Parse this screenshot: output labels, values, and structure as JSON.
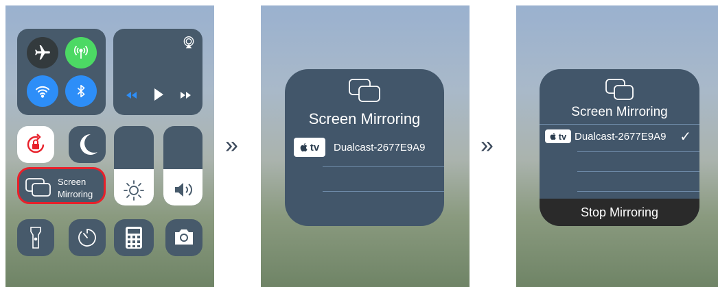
{
  "control_center": {
    "mirroring_label_line1": "Screen",
    "mirroring_label_line2": "Mirroring",
    "colors": {
      "highlight_outline": "#e8202a",
      "cellular_green": "#4cd964",
      "blue": "#2d8ef8"
    },
    "icons": [
      "airplane-icon",
      "cellular-icon",
      "wifi-icon",
      "bluetooth-icon",
      "airplay-icon",
      "rewind-icon",
      "play-icon",
      "fast-forward-icon",
      "rotation-lock-icon",
      "moon-icon",
      "screen-mirroring-icon",
      "brightness-icon",
      "volume-icon",
      "flashlight-icon",
      "timer-icon",
      "calculator-icon",
      "camera-icon"
    ]
  },
  "step_arrow": "»",
  "mirroring_dialog": {
    "title": "Screen Mirroring",
    "tv_badge": "tv",
    "device_name": "Dualcast-2677E9A9"
  },
  "mirroring_connected": {
    "title": "Screen Mirroring",
    "tv_badge": "tv",
    "device_name": "Dualcast-2677E9A9",
    "check": "✓",
    "stop_button": "Stop Mirroring"
  }
}
